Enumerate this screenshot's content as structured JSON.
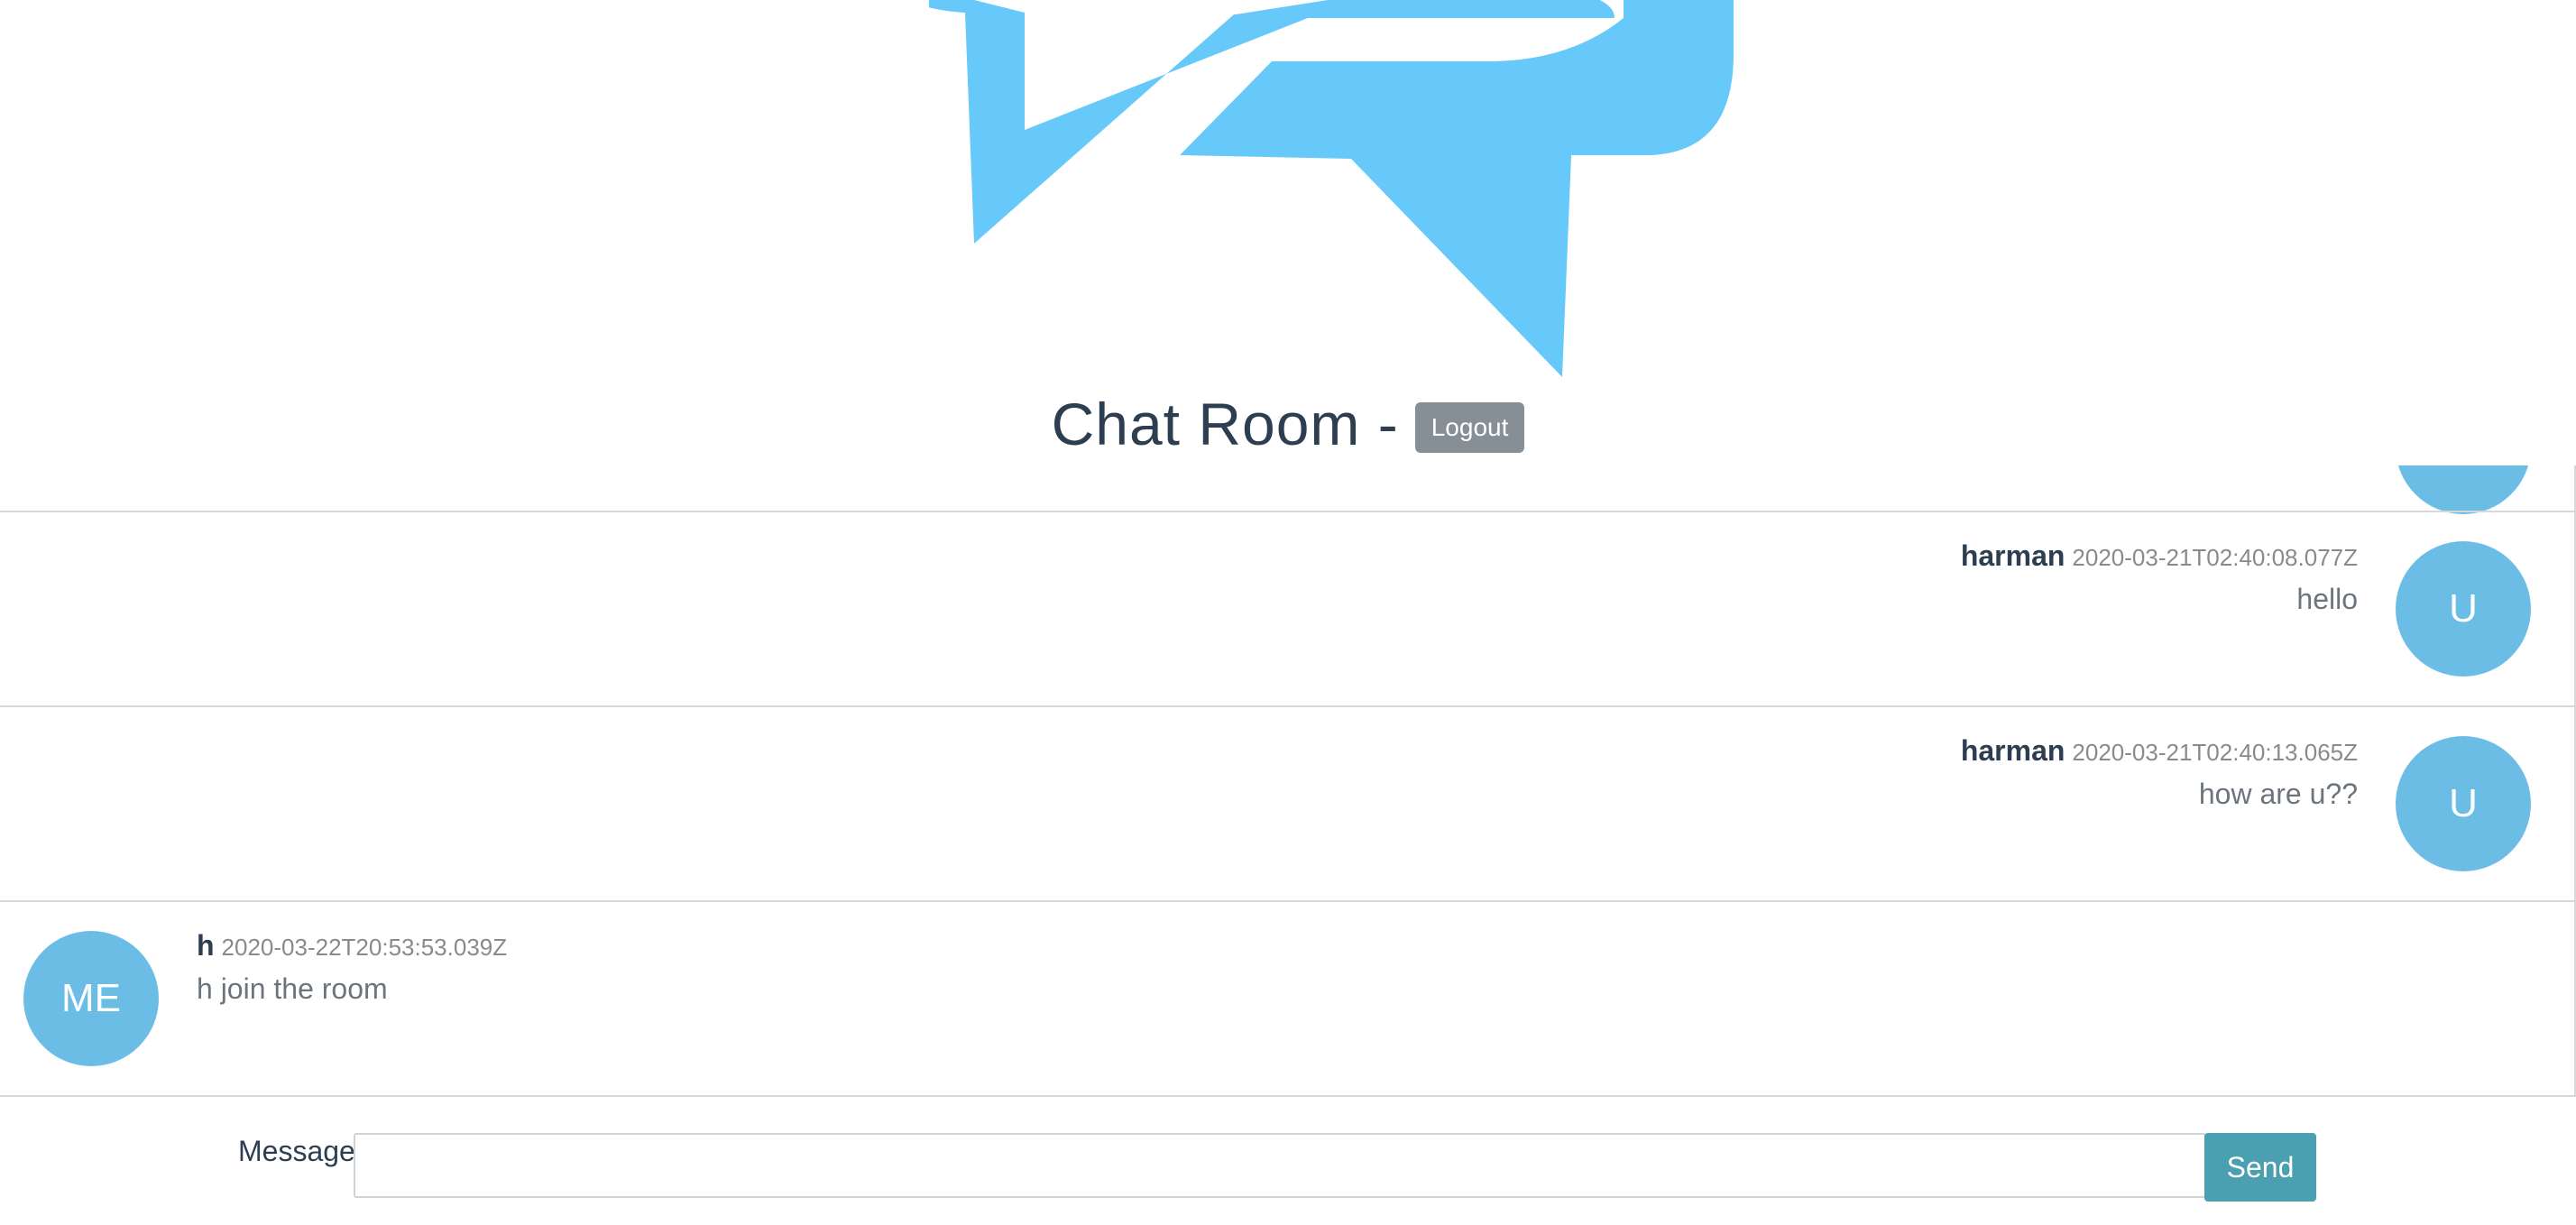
{
  "colors": {
    "accent": "#66c9fa",
    "avatar": "#6cbde6",
    "logout": "#868e96",
    "send": "#4a9fb0",
    "title": "#2c3e50"
  },
  "header": {
    "logo_icon": "chat-bubbles-icon",
    "title": "Chat Room -",
    "logout_label": "Logout"
  },
  "messages": [
    {
      "author": "harman",
      "timestamp": "2020-03-21T02:40:08.077Z",
      "text": "hello",
      "avatar": "U",
      "side": "right"
    },
    {
      "author": "harman",
      "timestamp": "2020-03-21T02:40:13.065Z",
      "text": "how are u??",
      "avatar": "U",
      "side": "right"
    },
    {
      "author": "h",
      "timestamp": "2020-03-22T20:53:53.039Z",
      "text": "h join the room",
      "avatar": "ME",
      "side": "left"
    }
  ],
  "composer": {
    "label": "Message",
    "value": "",
    "placeholder": "",
    "send_label": "Send"
  }
}
